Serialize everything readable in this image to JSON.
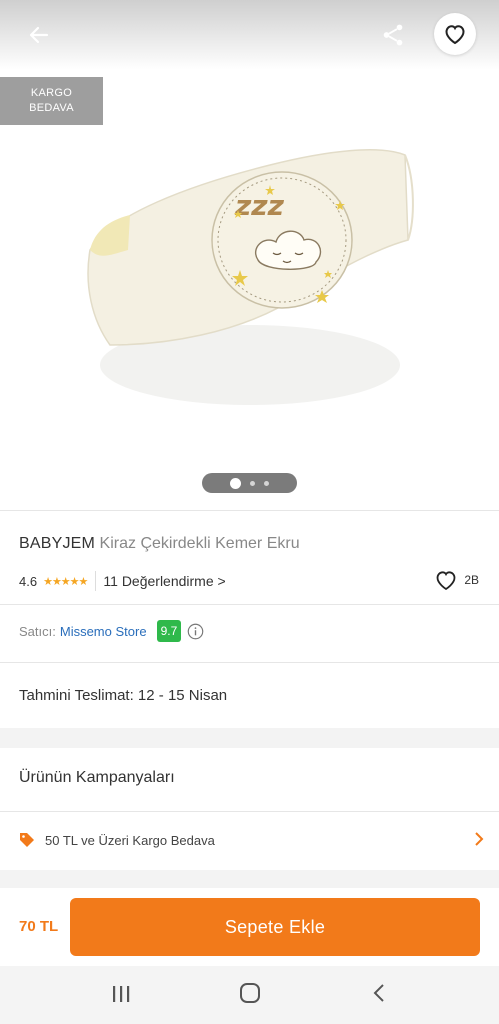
{
  "header": {
    "back_icon": "arrow-left-icon",
    "share_icon": "share-icon",
    "favorite_icon": "heart-outline-icon"
  },
  "badge": {
    "line1": "KARGO",
    "line2": "BEDAVA"
  },
  "product": {
    "brand": "BABYJEM",
    "name": "Kiraz Çekirdekli Kemer Ekru",
    "rating": "4.6",
    "reviews_link": "11 Değerlendirme >",
    "likes": "2B",
    "star_fill_fraction": 0.92
  },
  "gallery": {
    "page_count": 3,
    "current_page": 1
  },
  "seller": {
    "label": "Satıcı:",
    "name": "Missemo Store",
    "score": "9.7"
  },
  "delivery": {
    "text": "Tahmini Teslimat: 12 - 15 Nisan"
  },
  "campaigns": {
    "title": "Ürünün Kampanyaları",
    "items": [
      {
        "text": "50 TL ve Üzeri Kargo Bedava"
      }
    ]
  },
  "buybar": {
    "price": "70 TL",
    "button_label": "Sepete Ekle"
  },
  "colors": {
    "accent": "#f27a1a",
    "seller_link": "#2a6ebb",
    "score_bg": "#2fb94b",
    "star": "#f5a623"
  }
}
